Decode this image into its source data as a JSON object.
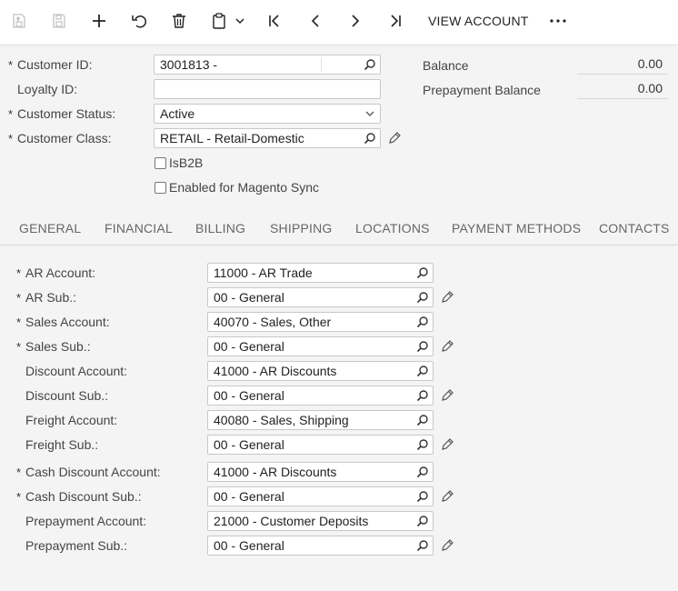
{
  "toolbar": {
    "view_account_label": "VIEW ACCOUNT"
  },
  "icons": [
    "save-close-icon",
    "save-icon",
    "add-icon",
    "undo-icon",
    "delete-icon",
    "copy-paste-icon",
    "chevron-down-icon",
    "first-record-icon",
    "previous-record-icon",
    "next-record-icon",
    "last-record-icon",
    "more-icon",
    "search-icon",
    "pencil-icon"
  ],
  "header": {
    "customer_id_label": "Customer ID:",
    "customer_id_value": "3001813 -",
    "loyalty_id_label": "Loyalty ID:",
    "loyalty_id_value": "",
    "customer_status_label": "Customer Status:",
    "customer_status_value": "Active",
    "customer_class_label": "Customer Class:",
    "customer_class_value": "RETAIL - Retail-Domestic",
    "isb2b_label": "IsB2B",
    "magento_label": "Enabled for Magento Sync",
    "balance_label": "Balance",
    "balance_value": "0.00",
    "prepayment_balance_label": "Prepayment Balance",
    "prepayment_balance_value": "0.00",
    "required_mark": "*"
  },
  "tabs": [
    "GENERAL",
    "FINANCIAL",
    "BILLING",
    "SHIPPING",
    "LOCATIONS",
    "PAYMENT METHODS",
    "CONTACTS"
  ],
  "gl_accounts": [
    {
      "label": "AR Account:",
      "value": "11000 - AR Trade"
    },
    {
      "label": "AR Sub.:",
      "value": "00 - General"
    },
    {
      "label": "Sales Account:",
      "value": "40070 - Sales, Other"
    },
    {
      "label": "Sales Sub.:",
      "value": "00 - General"
    },
    {
      "label": "Discount Account:",
      "value": "41000 - AR Discounts"
    },
    {
      "label": "Discount Sub.:",
      "value": "00 - General"
    },
    {
      "label": "Freight Account:",
      "value": "40080 - Sales, Shipping"
    },
    {
      "label": "Freight Sub.:",
      "value": "00 - General"
    },
    {
      "label": "Cash Discount Account:",
      "value": "41000 - AR Discounts"
    },
    {
      "label": "Cash Discount Sub.:",
      "value": "00 - General"
    },
    {
      "label": "Prepayment Account:",
      "value": "21000 - Customer Deposits"
    },
    {
      "label": "Prepayment Sub.:",
      "value": "00 - General"
    }
  ]
}
